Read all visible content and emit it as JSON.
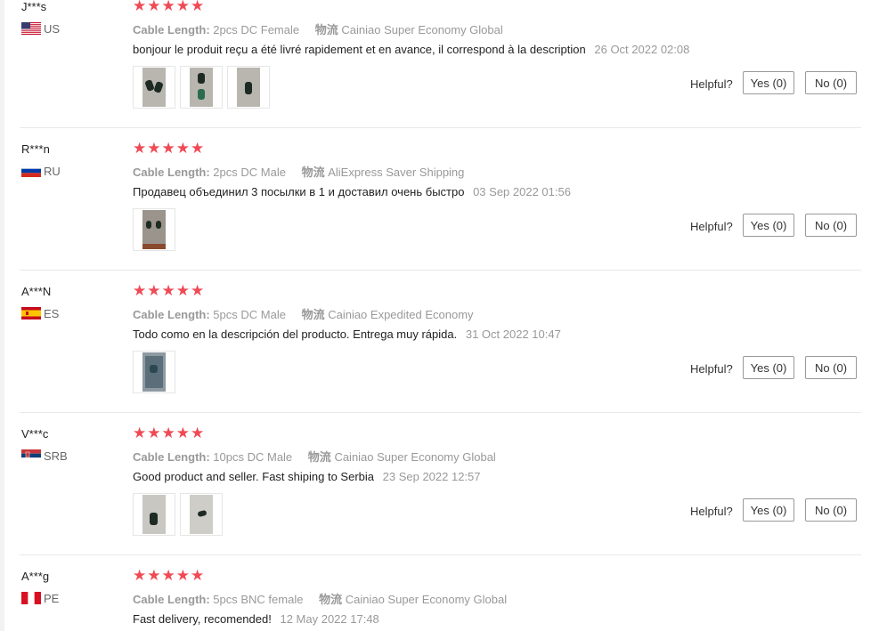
{
  "helpful_label": "Helpful?",
  "colors": {
    "star": "#ef4a55",
    "muted": "#999999",
    "divider": "#e8e8e8"
  },
  "reviews": [
    {
      "user": "J***s",
      "country": "US",
      "flag": "us-flag",
      "stars": 5,
      "attr_label": "Cable Length:",
      "attr_value": "2pcs DC Female",
      "ship_label": "物流",
      "ship_value": "Cainiao Super Economy Global",
      "text": "bonjour le produit reçu a été livré rapidement et en avance, il correspond à la description",
      "date": "26 Oct 2022 02:08",
      "yes": "Yes (0)",
      "no": "No (0)"
    },
    {
      "user": "R***n",
      "country": "RU",
      "flag": "ru-flag",
      "stars": 5,
      "attr_label": "Cable Length:",
      "attr_value": "2pcs DC Male",
      "ship_label": "物流",
      "ship_value": "AliExpress Saver Shipping",
      "text": "Продавец объединил 3 посылки в 1 и доставил очень быстро",
      "date": "03 Sep 2022 01:56",
      "yes": "Yes (0)",
      "no": "No (0)"
    },
    {
      "user": "A***N",
      "country": "ES",
      "flag": "es-flag",
      "stars": 5,
      "attr_label": "Cable Length:",
      "attr_value": "5pcs DC Male",
      "ship_label": "物流",
      "ship_value": "Cainiao Expedited Economy",
      "text": "Todo como en la descripción del producto. Entrega muy rápida.",
      "date": "31 Oct 2022 10:47",
      "yes": "Yes (0)",
      "no": "No (0)"
    },
    {
      "user": "V***c",
      "country": "SRB",
      "flag": "rs-flag",
      "stars": 5,
      "attr_label": "Cable Length:",
      "attr_value": "10pcs DC Male",
      "ship_label": "物流",
      "ship_value": "Cainiao Super Economy Global",
      "text": "Good product and seller. Fast shiping to Serbia",
      "date": "23 Sep 2022 12:57",
      "yes": "Yes (0)",
      "no": "No (0)"
    },
    {
      "user": "A***g",
      "country": "PE",
      "flag": "pe-flag",
      "stars": 5,
      "attr_label": "Cable Length:",
      "attr_value": "5pcs BNC female",
      "ship_label": "物流",
      "ship_value": "Cainiao Super Economy Global",
      "text": "Fast delivery, recomended!",
      "date": "12 May 2022 17:48"
    }
  ]
}
